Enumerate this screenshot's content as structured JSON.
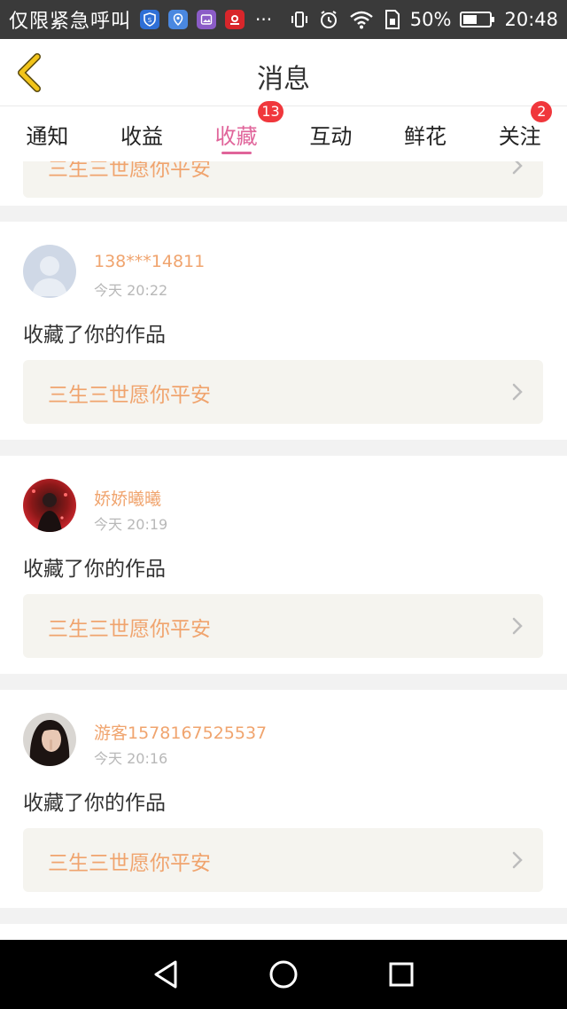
{
  "status_bar": {
    "carrier": "仅限紧急呼叫",
    "dots": "···",
    "battery_percent": "50%",
    "time": "20:48"
  },
  "header": {
    "title": "消息"
  },
  "tabs": [
    {
      "label": "通知",
      "badge": null,
      "active": false
    },
    {
      "label": "收益",
      "badge": null,
      "active": false
    },
    {
      "label": "收藏",
      "badge": "13",
      "active": true
    },
    {
      "label": "互动",
      "badge": null,
      "active": false
    },
    {
      "label": "鲜花",
      "badge": null,
      "active": false
    },
    {
      "label": "关注",
      "badge": "2",
      "active": false
    }
  ],
  "partial_item": {
    "work_title": "三生三世愿你平安"
  },
  "items": [
    {
      "user": "138***14811",
      "time": "今天 20:22",
      "action": "收藏了你的作品",
      "work_title": "三生三世愿你平安"
    },
    {
      "user": "娇娇曦曦",
      "time": "今天 20:19",
      "action": "收藏了你的作品",
      "work_title": "三生三世愿你平安"
    },
    {
      "user": "游客1578167525537",
      "time": "今天 20:16",
      "action": "收藏了你的作品",
      "work_title": "三生三世愿你平安"
    }
  ],
  "colors": {
    "accent_pink": "#e0649a",
    "orange_text": "#f0a46e",
    "badge_red": "#f0373c",
    "back_arrow": "#f2c419"
  }
}
